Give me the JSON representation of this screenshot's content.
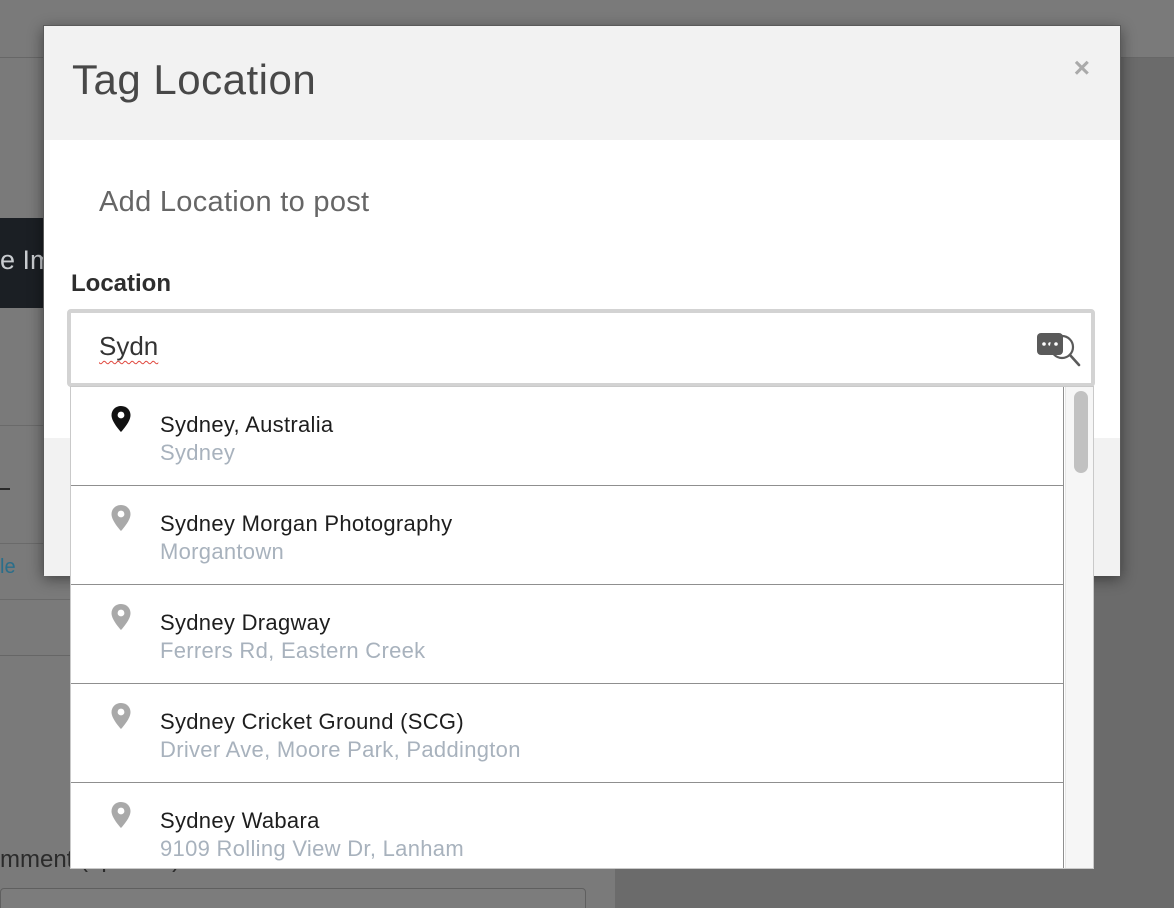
{
  "background": {
    "button_fragment": "e Im",
    "link_fragment": "le",
    "comment_label_fragment": "mment (optional)"
  },
  "modal": {
    "title": "Tag Location",
    "close_label": "×",
    "subtitle": "Add Location to post",
    "location_label": "Location",
    "search_value": "Sydn"
  },
  "results": [
    {
      "name": "Sydney, Australia",
      "sub": "Sydney",
      "icon": "map-pin-icon",
      "highlighted": true
    },
    {
      "name": "Sydney Morgan Photography",
      "sub": "Morgantown",
      "icon": "map-pin-icon",
      "highlighted": false
    },
    {
      "name": "Sydney Dragway",
      "sub": "Ferrers Rd, Eastern Creek",
      "icon": "map-pin-icon",
      "highlighted": false
    },
    {
      "name": "Sydney Cricket Ground (SCG)",
      "sub": "Driver Ave, Moore Park, Paddington",
      "icon": "map-pin-icon",
      "highlighted": false
    },
    {
      "name": "Sydney Wabara",
      "sub": "9109 Rolling View Dr, Lanham",
      "icon": "map-pin-icon",
      "highlighted": false
    }
  ],
  "colors": {
    "pin_active": "#111111",
    "pin_inactive": "#a9a9a9",
    "subtext": "#a8b2bd",
    "accent_blue": "#3b8fd6"
  }
}
